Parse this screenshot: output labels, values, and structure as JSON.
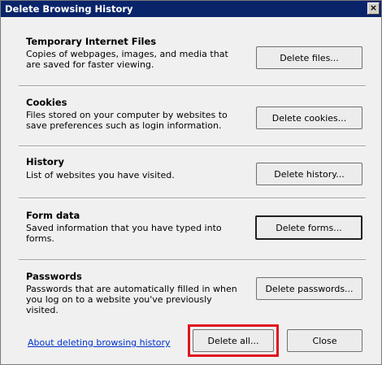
{
  "dialog": {
    "title": "Delete Browsing History",
    "close_glyph": "✕"
  },
  "sections": [
    {
      "title": "Temporary Internet Files",
      "description": "Copies of webpages, images, and media that are saved for faster viewing.",
      "button": "Delete files..."
    },
    {
      "title": "Cookies",
      "description": "Files stored on your computer by websites to save preferences such as login information.",
      "button": "Delete cookies..."
    },
    {
      "title": "History",
      "description": "List of websites you have visited.",
      "button": "Delete history..."
    },
    {
      "title": "Form data",
      "description": "Saved information that you have typed into forms.",
      "button": "Delete forms..."
    },
    {
      "title": "Passwords",
      "description": "Passwords that are automatically filled in when you log on to a website you've previously visited.",
      "button": "Delete passwords..."
    }
  ],
  "footer": {
    "link": "About deleting browsing history",
    "delete_all": "Delete all...",
    "close": "Close"
  },
  "colors": {
    "title_bar": "#0a246a",
    "link": "#0033cc",
    "highlight": "#e0141f"
  }
}
